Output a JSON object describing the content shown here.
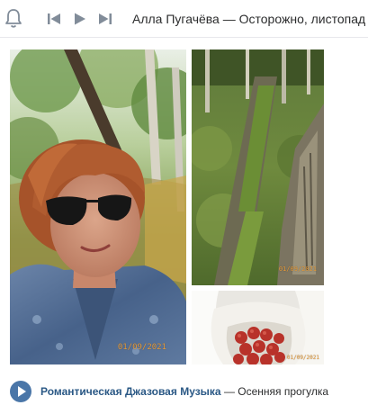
{
  "player": {
    "artist": "Алла Пугачёва",
    "separator": " — ",
    "title": "Осторожно, листопад",
    "icons": [
      "bell-icon",
      "previous-icon",
      "play-icon",
      "next-icon"
    ]
  },
  "post": {
    "photos": [
      {
        "name": "selfie-in-birch-forest",
        "date_stamp": "01/09/2021"
      },
      {
        "name": "mossy-fallen-log",
        "date_stamp": "01/09/2021"
      },
      {
        "name": "bag-of-red-berries",
        "date_stamp": "01/09/2021"
      }
    ],
    "audio": {
      "artist": "Романтическая Джазовая Музыка",
      "dash": " — ",
      "title": "Осенняя прогулка",
      "icon": "play-circle-icon"
    }
  },
  "colors": {
    "accent": "#4a76a8",
    "link": "#2a5885",
    "icon_gray": "#818c99",
    "date_stamp": "#e89c3a"
  }
}
